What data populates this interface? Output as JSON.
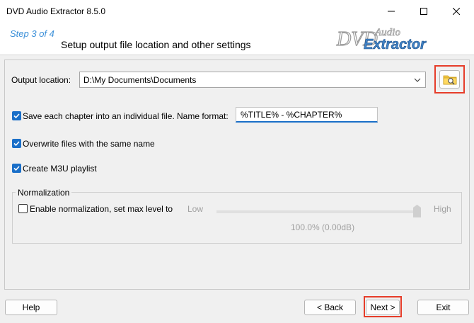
{
  "window": {
    "title": "DVD Audio Extractor 8.5.0"
  },
  "header": {
    "step": "Step 3 of 4",
    "subtitle": "Setup output file location and other settings",
    "logo_text_top": "DVD",
    "logo_text_script": "Audio",
    "logo_text_main": "Extractor"
  },
  "output": {
    "label": "Output location:",
    "value": "D:\\My Documents\\Documents"
  },
  "options": {
    "save_chapter": {
      "label": "Save each chapter into an individual file.",
      "checked": true
    },
    "name_format_label": "Name format:",
    "name_format_value": "%TITLE% - %CHAPTER%",
    "overwrite": {
      "label": "Overwrite files with the same name",
      "checked": true
    },
    "m3u": {
      "label": "Create M3U playlist",
      "checked": true
    }
  },
  "normalization": {
    "group_label": "Normalization",
    "enable_label": "Enable normalization, set max level to",
    "checked": false,
    "low_label": "Low",
    "high_label": "High",
    "level_text": "100.0% (0.00dB)",
    "level_fraction": 1.0
  },
  "footer": {
    "help": "Help",
    "back": "< Back",
    "next": "Next >",
    "exit": "Exit"
  },
  "colors": {
    "accent": "#1a6fc8",
    "highlight": "#e63d2a",
    "step_text": "#3a8fd8"
  }
}
